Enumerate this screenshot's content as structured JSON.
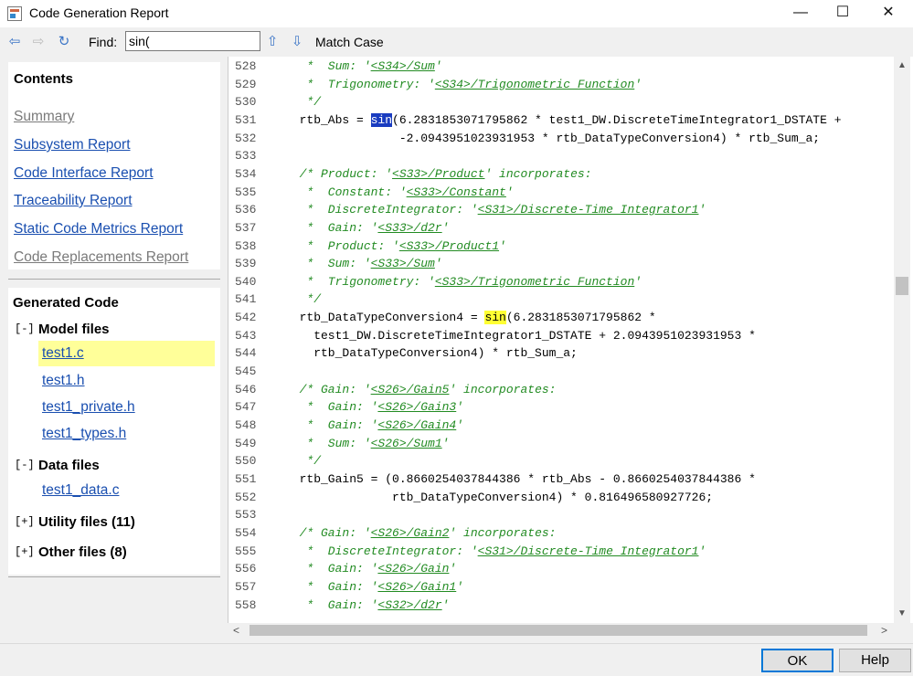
{
  "window": {
    "title": "Code Generation Report",
    "minimize_glyph": "—",
    "maximize_glyph": "☐",
    "close_glyph": "✕"
  },
  "toolbar": {
    "back_icon": "arrow-left-icon",
    "forward_icon": "arrow-right-icon",
    "refresh_icon": "refresh-icon",
    "find_label": "Find:",
    "find_value": "sin(",
    "find_up_icon": "arrow-up-icon",
    "find_down_icon": "arrow-down-icon",
    "match_case_label": "Match Case"
  },
  "contents": {
    "heading": "Contents",
    "links": [
      {
        "label": "Summary",
        "enabled": false
      },
      {
        "label": "Subsystem Report",
        "enabled": true
      },
      {
        "label": "Code Interface Report",
        "enabled": true
      },
      {
        "label": "Traceability Report",
        "enabled": true
      },
      {
        "label": "Static Code Metrics Report",
        "enabled": true
      },
      {
        "label": "Code Replacements Report",
        "enabled": false
      }
    ]
  },
  "generated_code": {
    "heading": "Generated Code",
    "model_files": {
      "toggle": "[-]",
      "label": "Model files",
      "files": [
        "test1.c",
        "test1.h",
        "test1_private.h",
        "test1_types.h"
      ],
      "selected": "test1.c"
    },
    "data_files": {
      "toggle": "[-]",
      "label": "Data files",
      "files": [
        "test1_data.c"
      ]
    },
    "utility_files": {
      "toggle": "[+]",
      "label": "Utility files (11)"
    },
    "other_files": {
      "toggle": "[+]",
      "label": "Other files (8)"
    }
  },
  "code": {
    "lines": [
      {
        "n": "528",
        "t": "   *  Sum: '<S34>/Sum'"
      },
      {
        "n": "529",
        "t": "   *  Trigonometry: '<S34>/Trigonometric Function'"
      },
      {
        "n": "530",
        "t": "   */"
      },
      {
        "n": "531",
        "t": "  rtb_Abs = sin(6.2831853071795862 * test1_DW.DiscreteTimeIntegrator1_DSTATE +"
      },
      {
        "n": "532",
        "t": "                -2.0943951023931953 * rtb_DataTypeConversion4) * rtb_Sum_a;"
      },
      {
        "n": "533",
        "t": ""
      },
      {
        "n": "534",
        "t": "  /* Product: '<S33>/Product' incorporates:"
      },
      {
        "n": "535",
        "t": "   *  Constant: '<S33>/Constant'"
      },
      {
        "n": "536",
        "t": "   *  DiscreteIntegrator: '<S31>/Discrete-Time Integrator1'"
      },
      {
        "n": "537",
        "t": "   *  Gain: '<S33>/d2r'"
      },
      {
        "n": "538",
        "t": "   *  Product: '<S33>/Product1'"
      },
      {
        "n": "539",
        "t": "   *  Sum: '<S33>/Sum'"
      },
      {
        "n": "540",
        "t": "   *  Trigonometry: '<S33>/Trigonometric Function'"
      },
      {
        "n": "541",
        "t": "   */"
      },
      {
        "n": "542",
        "t": "  rtb_DataTypeConversion4 = sin(6.2831853071795862 *"
      },
      {
        "n": "543",
        "t": "    test1_DW.DiscreteTimeIntegrator1_DSTATE + 2.0943951023931953 *"
      },
      {
        "n": "544",
        "t": "    rtb_DataTypeConversion4) * rtb_Sum_a;"
      },
      {
        "n": "545",
        "t": ""
      },
      {
        "n": "546",
        "t": "  /* Gain: '<S26>/Gain5' incorporates:"
      },
      {
        "n": "547",
        "t": "   *  Gain: '<S26>/Gain3'"
      },
      {
        "n": "548",
        "t": "   *  Gain: '<S26>/Gain4'"
      },
      {
        "n": "549",
        "t": "   *  Sum: '<S26>/Sum1'"
      },
      {
        "n": "550",
        "t": "   */"
      },
      {
        "n": "551",
        "t": "  rtb_Gain5 = (0.8660254037844386 * rtb_Abs - 0.8660254037844386 *"
      },
      {
        "n": "552",
        "t": "               rtb_DataTypeConversion4) * 0.816496580927726;"
      },
      {
        "n": "553",
        "t": ""
      },
      {
        "n": "554",
        "t": "  /* Gain: '<S26>/Gain2' incorporates:"
      },
      {
        "n": "555",
        "t": "   *  DiscreteIntegrator: '<S31>/Discrete-Time Integrator1'"
      },
      {
        "n": "556",
        "t": "   *  Gain: '<S26>/Gain'"
      },
      {
        "n": "557",
        "t": "   *  Gain: '<S26>/Gain1'"
      },
      {
        "n": "558",
        "t": "   *  Gain: '<S32>/d2r'"
      }
    ]
  },
  "buttons": {
    "ok": "OK",
    "help": "Help"
  },
  "colors": {
    "link": "#1a4fb0",
    "comment": "#228b22",
    "selection": "#1a3cc0",
    "match_highlight": "#ffff33",
    "file_highlight": "#ffff99"
  }
}
